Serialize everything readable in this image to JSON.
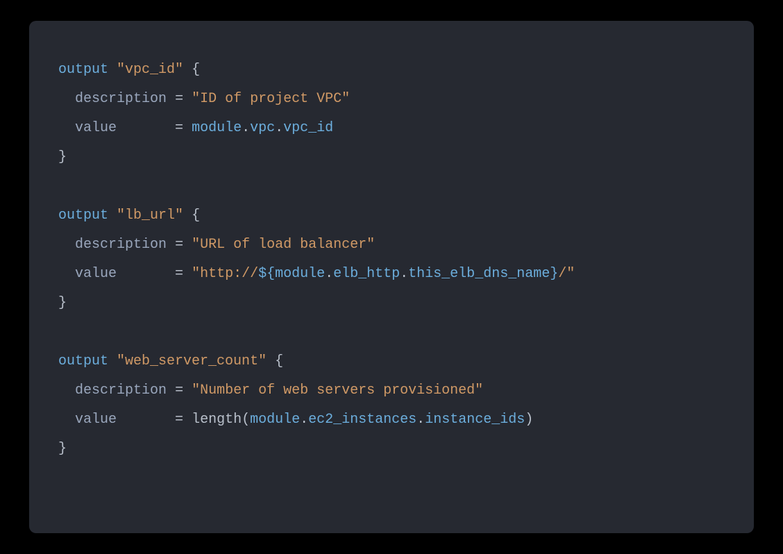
{
  "code": {
    "outputs": [
      {
        "kw": "output",
        "name": "\"vpc_id\"",
        "open": "{",
        "desc_attr": "description",
        "desc_eq": "=",
        "desc_val": "\"ID of project VPC\"",
        "val_attr": "value",
        "val_eq": "=",
        "val_tokens": [
          {
            "t": "module",
            "c": "tok-ident"
          },
          {
            "t": ".",
            "c": "tok-dot"
          },
          {
            "t": "vpc",
            "c": "tok-ident"
          },
          {
            "t": ".",
            "c": "tok-dot"
          },
          {
            "t": "vpc_id",
            "c": "tok-ident"
          }
        ],
        "close": "}"
      },
      {
        "kw": "output",
        "name": "\"lb_url\"",
        "open": "{",
        "desc_attr": "description",
        "desc_eq": "=",
        "desc_val": "\"URL of load balancer\"",
        "val_attr": "value",
        "val_eq": "=",
        "val_tokens": [
          {
            "t": "\"http://",
            "c": "tok-string"
          },
          {
            "t": "${",
            "c": "tok-interp"
          },
          {
            "t": "module",
            "c": "tok-ident"
          },
          {
            "t": ".",
            "c": "tok-dot"
          },
          {
            "t": "elb_http",
            "c": "tok-ident"
          },
          {
            "t": ".",
            "c": "tok-dot"
          },
          {
            "t": "this_elb_dns_name",
            "c": "tok-ident"
          },
          {
            "t": "}",
            "c": "tok-interp"
          },
          {
            "t": "/\"",
            "c": "tok-string"
          }
        ],
        "close": "}"
      },
      {
        "kw": "output",
        "name": "\"web_server_count\"",
        "open": "{",
        "desc_attr": "description",
        "desc_eq": "=",
        "desc_val": "\"Number of web servers provisioned\"",
        "val_attr": "value",
        "val_eq": "=",
        "val_tokens": [
          {
            "t": "length",
            "c": "tok-func"
          },
          {
            "t": "(",
            "c": "tok-punct"
          },
          {
            "t": "module",
            "c": "tok-ident"
          },
          {
            "t": ".",
            "c": "tok-dot"
          },
          {
            "t": "ec2_instances",
            "c": "tok-ident"
          },
          {
            "t": ".",
            "c": "tok-dot"
          },
          {
            "t": "instance_ids",
            "c": "tok-ident"
          },
          {
            "t": ")",
            "c": "tok-punct"
          }
        ],
        "close": "}"
      }
    ]
  }
}
